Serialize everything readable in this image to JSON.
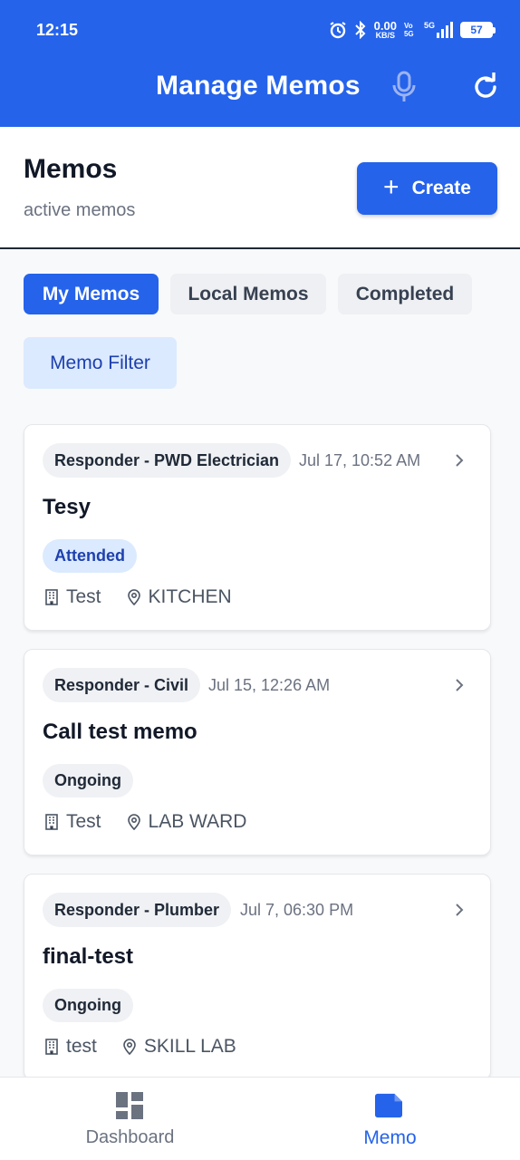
{
  "status_bar": {
    "time": "12:15",
    "net_speed": "0.00",
    "net_unit": "KB/S",
    "volte": "Vo 5G",
    "network": "5G",
    "battery": "57"
  },
  "app_bar": {
    "title": "Manage Memos",
    "mic_icon": "mic-icon",
    "refresh_icon": "refresh-icon"
  },
  "header": {
    "title": "Memos",
    "subtitle": "active memos",
    "create_label": "Create"
  },
  "tabs": [
    {
      "label": "My Memos",
      "active": true
    },
    {
      "label": "Local Memos",
      "active": false
    },
    {
      "label": "Completed",
      "active": false
    }
  ],
  "filter_label": "Memo Filter",
  "memos": [
    {
      "role": "Responder - PWD Electrician",
      "date": "Jul 17, 10:52 AM",
      "title": "Tesy",
      "status": "Attended",
      "building": "Test",
      "location": "KITCHEN"
    },
    {
      "role": "Responder - Civil",
      "date": "Jul 15, 12:26 AM",
      "title": "Call test memo",
      "status": "Ongoing",
      "building": "Test",
      "location": "LAB WARD"
    },
    {
      "role": "Responder - Plumber",
      "date": "Jul 7, 06:30 PM",
      "title": "final-test",
      "status": "Ongoing",
      "building": "test",
      "location": "SKILL LAB"
    }
  ],
  "bottom_nav": {
    "dashboard_label": "Dashboard",
    "memo_label": "Memo"
  },
  "colors": {
    "primary": "#2563eb",
    "badge_blue_bg": "#dbeafe",
    "badge_blue_text": "#1e40af"
  }
}
